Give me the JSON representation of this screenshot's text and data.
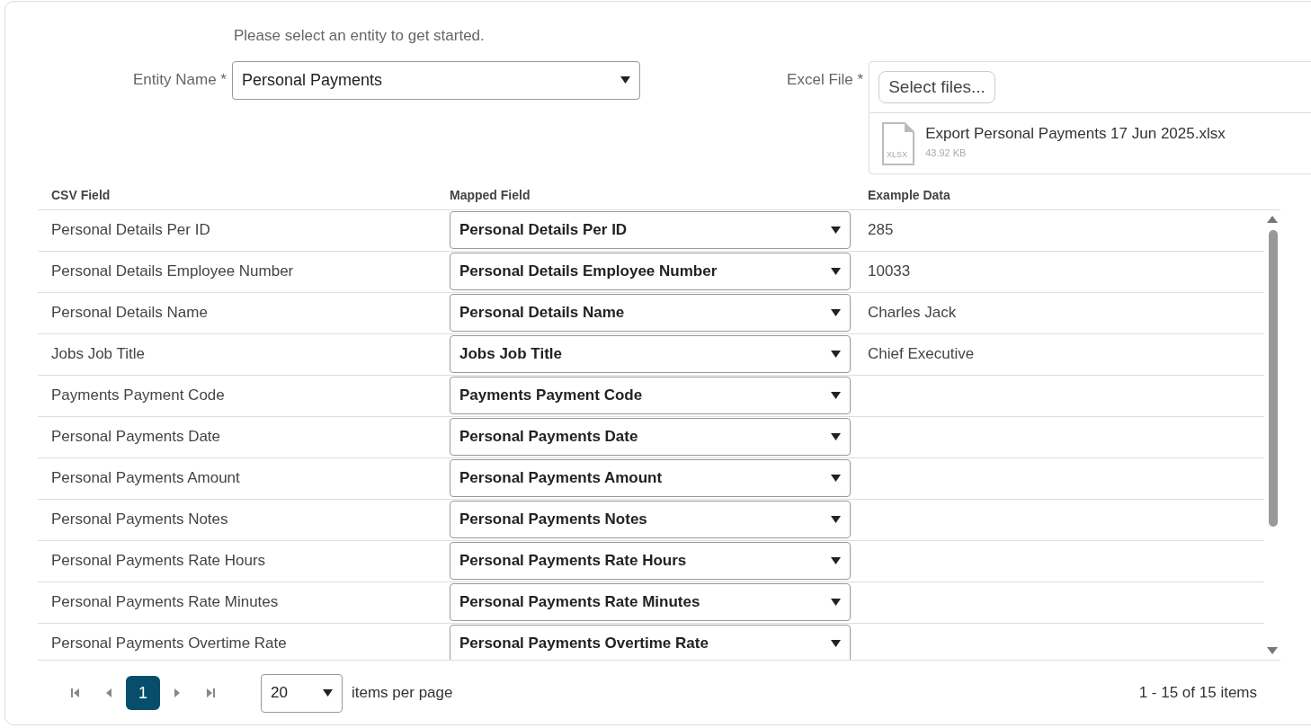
{
  "hint": "Please select an entity to get started.",
  "entity": {
    "label": "Entity Name *",
    "value": "Personal Payments"
  },
  "excel": {
    "label": "Excel File *",
    "button": "Select files...",
    "file": {
      "name": "Export Personal Payments 17 Jun 2025.xlsx",
      "type": "XLSX",
      "size": "43.92 KB"
    }
  },
  "table": {
    "columns": [
      "CSV Field",
      "Mapped Field",
      "Example Data"
    ],
    "rows": [
      {
        "csv": "Personal Details Per ID",
        "mapped": "Personal Details Per ID",
        "example": "285"
      },
      {
        "csv": "Personal Details Employee Number",
        "mapped": "Personal Details Employee Number",
        "example": "10033"
      },
      {
        "csv": "Personal Details Name",
        "mapped": "Personal Details Name",
        "example": "Charles Jack"
      },
      {
        "csv": "Jobs Job Title",
        "mapped": "Jobs Job Title",
        "example": "Chief Executive"
      },
      {
        "csv": "Payments Payment Code",
        "mapped": "Payments Payment Code"
      },
      {
        "csv": "Personal Payments Date",
        "mapped": "Personal Payments Date"
      },
      {
        "csv": "Personal Payments Amount",
        "mapped": "Personal Payments Amount"
      },
      {
        "csv": "Personal Payments Notes",
        "mapped": "Personal Payments Notes"
      },
      {
        "csv": "Personal Payments Rate Hours",
        "mapped": "Personal Payments Rate Hours"
      },
      {
        "csv": "Personal Payments Rate Minutes",
        "mapped": "Personal Payments Rate Minutes"
      },
      {
        "csv": "Personal Payments Overtime Rate",
        "mapped": "Personal Payments Overtime Rate"
      }
    ]
  },
  "pager": {
    "pages": [
      {
        "label": "1",
        "selected": true
      }
    ],
    "page_size": "20",
    "page_size_label": "items per page",
    "info": "1 - 15 of 15 items"
  }
}
